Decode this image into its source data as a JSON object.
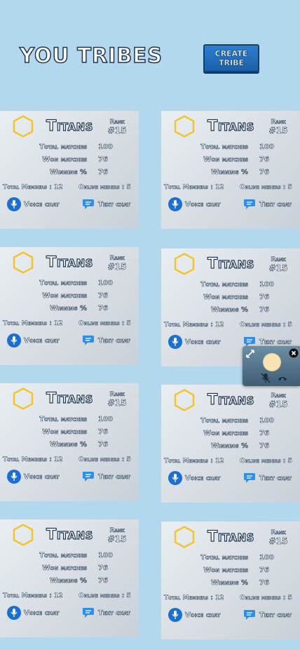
{
  "page": {
    "title": "You tribes",
    "create_button": "Create tribe"
  },
  "labels": {
    "rank": "Rank",
    "total_matches": "Total matches",
    "won_matches": "Won matches",
    "winning_pct": "Winning %",
    "voice_chat": "Voice chat",
    "text_chat": "Text chat"
  },
  "tribes": [
    {
      "name": "Titans",
      "rank": "#15",
      "total_matches": "100",
      "won_matches": "76",
      "winning_pct": "76",
      "members": "Total Members : 12",
      "online": "Online mebers : 5"
    },
    {
      "name": "Titans",
      "rank": "#15",
      "total_matches": "100",
      "won_matches": "76",
      "winning_pct": "76",
      "members": "Total Members : 12",
      "online": "Online mebers : 5"
    },
    {
      "name": "Titans",
      "rank": "#15",
      "total_matches": "100",
      "won_matches": "76",
      "winning_pct": "76",
      "members": "Total Members : 12",
      "online": "Online mebers : 5"
    },
    {
      "name": "Titans",
      "rank": "#15",
      "total_matches": "100",
      "won_matches": "76",
      "winning_pct": "76",
      "members": "Total Members : 12",
      "online": "Online mebers : 5"
    },
    {
      "name": "Titans",
      "rank": "#15",
      "total_matches": "100",
      "won_matches": "76",
      "winning_pct": "76",
      "members": "Total Members : 12",
      "online": "Online mebers : 5"
    },
    {
      "name": "Titans",
      "rank": "#15",
      "total_matches": "100",
      "won_matches": "76",
      "winning_pct": "76",
      "members": "Total Members : 12",
      "online": "Online mebers : 5"
    },
    {
      "name": "Titans",
      "rank": "#15",
      "total_matches": "100",
      "won_matches": "76",
      "winning_pct": "76",
      "members": "Total Members : 12",
      "online": "Online mebers : 5"
    },
    {
      "name": "Titans",
      "rank": "#15",
      "total_matches": "100",
      "won_matches": "76",
      "winning_pct": "76",
      "members": "Total Members : 12",
      "online": "Online mebers : 5"
    }
  ],
  "icons": {
    "tribe_badge": "hexagon-icon",
    "voice": "microphone-icon",
    "text": "chat-bubble-icon",
    "expand": "expand-icon",
    "close": "close-icon",
    "mute": "mic-off-icon",
    "hangup": "hang-up-icon"
  },
  "colors": {
    "background": "#b3d8ee",
    "accent_blue": "#1b6fd1",
    "hex_gold": "#f4c430",
    "outline": "#1d3550"
  }
}
